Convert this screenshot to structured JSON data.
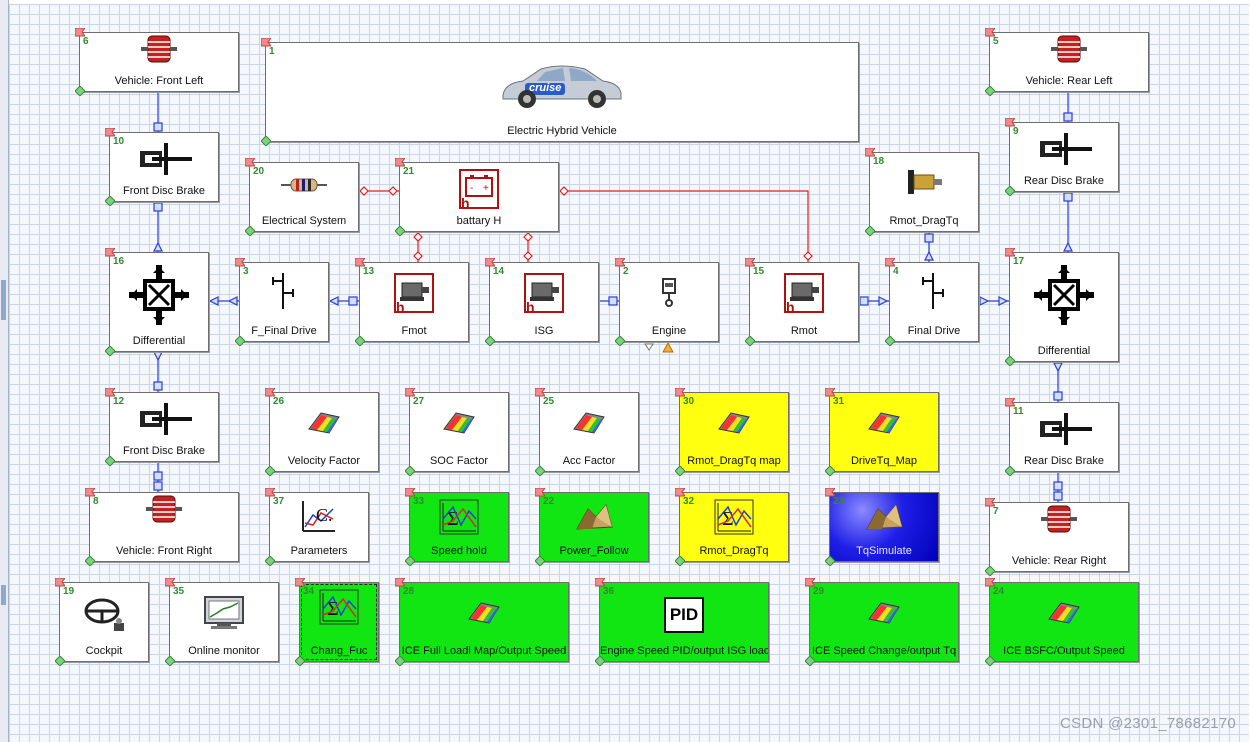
{
  "blocks": [
    {
      "key": "b6",
      "num": "6",
      "label": "Vehicle: Front Left",
      "icon": "wheel-icon"
    },
    {
      "key": "b1",
      "num": "1",
      "label": "Electric Hybrid Vehicle",
      "icon": "car-icon"
    },
    {
      "key": "b5",
      "num": "5",
      "label": "Vehicle: Rear Left",
      "icon": "wheel-icon"
    },
    {
      "key": "b10",
      "num": "10",
      "label": "Front Disc Brake",
      "icon": "disc-brake-icon"
    },
    {
      "key": "b9",
      "num": "9",
      "label": "Rear Disc Brake",
      "icon": "disc-brake-icon"
    },
    {
      "key": "b20",
      "num": "20",
      "label": "Electrical System",
      "icon": "resistor-icon"
    },
    {
      "key": "b21",
      "num": "21",
      "label": "battary H",
      "icon": "battery-icon"
    },
    {
      "key": "b18",
      "num": "18",
      "label": "Rmot_DragTq",
      "icon": "drag-torque-icon"
    },
    {
      "key": "b16",
      "num": "16",
      "label": "Differential",
      "icon": "differential-icon"
    },
    {
      "key": "b3",
      "num": "3",
      "label": "F_Final Drive",
      "icon": "final-drive-icon"
    },
    {
      "key": "b13",
      "num": "13",
      "label": "Fmot",
      "icon": "motor-icon"
    },
    {
      "key": "b14",
      "num": "14",
      "label": "ISG",
      "icon": "motor-icon"
    },
    {
      "key": "b2",
      "num": "2",
      "label": "Engine",
      "icon": "engine-icon"
    },
    {
      "key": "b15",
      "num": "15",
      "label": "Rmot",
      "icon": "motor-icon"
    },
    {
      "key": "b4",
      "num": "4",
      "label": "Final Drive",
      "icon": "final-drive-icon"
    },
    {
      "key": "b17",
      "num": "17",
      "label": "Differential",
      "icon": "differential-icon"
    },
    {
      "key": "b12",
      "num": "12",
      "label": "Front Disc Brake",
      "icon": "disc-brake-icon"
    },
    {
      "key": "b26",
      "num": "26",
      "label": "Velocity Factor",
      "icon": "map-surface-icon"
    },
    {
      "key": "b27",
      "num": "27",
      "label": "SOC Factor",
      "icon": "map-surface-icon"
    },
    {
      "key": "b25",
      "num": "25",
      "label": "Acc  Factor",
      "icon": "map-surface-icon"
    },
    {
      "key": "b30",
      "num": "30",
      "label": "Rmot_DragTq map",
      "icon": "map-surface-icon"
    },
    {
      "key": "b31",
      "num": "31",
      "label": "DriveTq_Map",
      "icon": "map-surface-icon"
    },
    {
      "key": "b11",
      "num": "11",
      "label": "Rear Disc Brake",
      "icon": "disc-brake-icon"
    },
    {
      "key": "b8",
      "num": "8",
      "label": "Vehicle: Front Right",
      "icon": "wheel-icon"
    },
    {
      "key": "b37",
      "num": "37",
      "label": "Parameters",
      "icon": "parameters-icon"
    },
    {
      "key": "b33",
      "num": "33",
      "label": "Speed hold",
      "icon": "function-icon"
    },
    {
      "key": "b22",
      "num": "22",
      "label": "Power_Follow",
      "icon": "simulink-icon"
    },
    {
      "key": "b32",
      "num": "32",
      "label": "Rmot_DragTq",
      "icon": "function-icon"
    },
    {
      "key": "b23",
      "num": "23",
      "label": "TqSimulate",
      "icon": "simulink-icon"
    },
    {
      "key": "b7",
      "num": "7",
      "label": "Vehicle: Rear Right",
      "icon": "wheel-icon"
    },
    {
      "key": "b19",
      "num": "19",
      "label": "Cockpit",
      "icon": "steering-wheel-icon"
    },
    {
      "key": "b35",
      "num": "35",
      "label": "Online monitor",
      "icon": "monitor-icon"
    },
    {
      "key": "b34",
      "num": "34",
      "label": "Chang_Fuc",
      "icon": "function-icon"
    },
    {
      "key": "b28",
      "num": "28",
      "label": "ICE Full Loadl Map/Output Speed",
      "icon": "map-surface-icon"
    },
    {
      "key": "b36",
      "num": "36",
      "label": "Engine Speed PID/output ISG load",
      "icon": "pid-icon"
    },
    {
      "key": "b29",
      "num": "29",
      "label": "ICE Speed Change/output Tq",
      "icon": "map-surface-icon"
    },
    {
      "key": "b24",
      "num": "24",
      "label": "ICE BSFC/Output Speed",
      "icon": "map-surface-icon"
    }
  ],
  "pid_text": "PID",
  "car_badge": "cruise",
  "watermark": "CSDN @2301_78682170",
  "colors": {
    "mechanical_wire": "#2a3dd6",
    "electrical_wire": "#e02020",
    "function_green": "#12e612",
    "map_yellow": "#ffff10",
    "simulate_blue": "#1e1ee6",
    "block_number": "#2e8b2e"
  }
}
